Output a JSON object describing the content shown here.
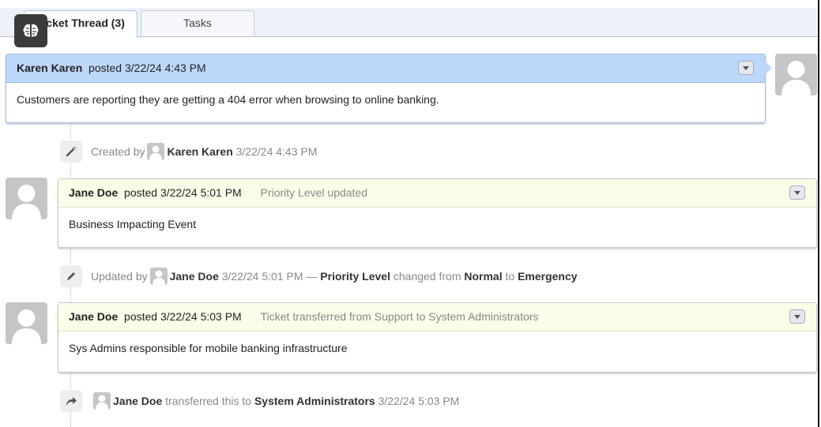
{
  "tabs": [
    {
      "label": "Ticket Thread (3)",
      "active": true
    },
    {
      "label": "Tasks",
      "active": false
    }
  ],
  "overlay_icon": "brain-icon",
  "posts": [
    {
      "author": "Karen Karen",
      "posted_label": "posted",
      "timestamp": "3/22/24 4:43 PM",
      "title": "",
      "body": "Customers are reporting they are getting a 404 error when browsing to online banking.",
      "style": "blue",
      "avatar_side": "right"
    },
    {
      "author": "Jane Doe",
      "posted_label": "posted",
      "timestamp": "3/22/24 5:01 PM",
      "title": "Priority Level updated",
      "body": "Business Impacting Event",
      "style": "yellow",
      "avatar_side": "left"
    },
    {
      "author": "Jane Doe",
      "posted_label": "posted",
      "timestamp": "3/22/24 5:03 PM",
      "title": "Ticket transferred from Support to System Administrators",
      "body": "Sys Admins responsible for mobile banking infrastructure",
      "style": "yellow",
      "avatar_side": "left"
    }
  ],
  "events": [
    {
      "icon": "magic-wand-icon",
      "prefix": "Created by",
      "user": "Karen Karen",
      "timestamp": "3/22/24 4:43 PM"
    },
    {
      "icon": "pencil-icon",
      "prefix": "Updated by",
      "user": "Jane Doe",
      "timestamp": "3/22/24 5:01 PM",
      "dash": "—",
      "field": "Priority Level",
      "changed_from": "changed from",
      "old_value": "Normal",
      "to": "to",
      "new_value": "Emergency"
    },
    {
      "icon": "share-arrow-icon",
      "user": "Jane Doe",
      "action": "transferred this to",
      "target": "System Administrators",
      "timestamp": "3/22/24 5:03 PM"
    }
  ]
}
